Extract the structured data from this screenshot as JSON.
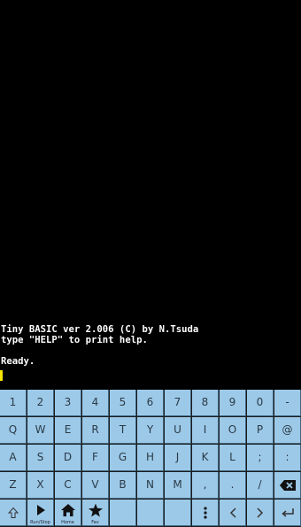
{
  "terminal": {
    "lines": [
      "Tiny BASIC ver 2.006 (C) by N.Tsuda",
      "type \"HELP\" to print help.",
      "",
      "Ready."
    ]
  },
  "keyboard": {
    "row1": [
      "1",
      "2",
      "3",
      "4",
      "5",
      "6",
      "7",
      "8",
      "9",
      "0",
      "-"
    ],
    "row2": [
      "Q",
      "W",
      "E",
      "R",
      "T",
      "Y",
      "U",
      "I",
      "O",
      "P",
      "@"
    ],
    "row3": [
      "A",
      "S",
      "D",
      "F",
      "G",
      "H",
      "J",
      "K",
      "L",
      ";",
      ":"
    ],
    "row4": [
      "Z",
      "X",
      "C",
      "V",
      "B",
      "N",
      "M",
      ",",
      ".",
      "/"
    ],
    "row5_labels": {
      "run_stop": "Run/Stop",
      "home": "Home",
      "fav": "Fav"
    },
    "icons": {
      "backspace": "backspace-icon",
      "shift": "shift-icon",
      "play": "play-icon",
      "home": "home-icon",
      "star": "star-icon",
      "menu": "more-vertical-icon",
      "left": "arrow-left-icon",
      "right": "arrow-right-icon",
      "enter": "enter-icon"
    }
  },
  "colors": {
    "key_bg": "#9cc9e8",
    "cursor": "#f5e400",
    "terminal_bg": "#000000"
  }
}
